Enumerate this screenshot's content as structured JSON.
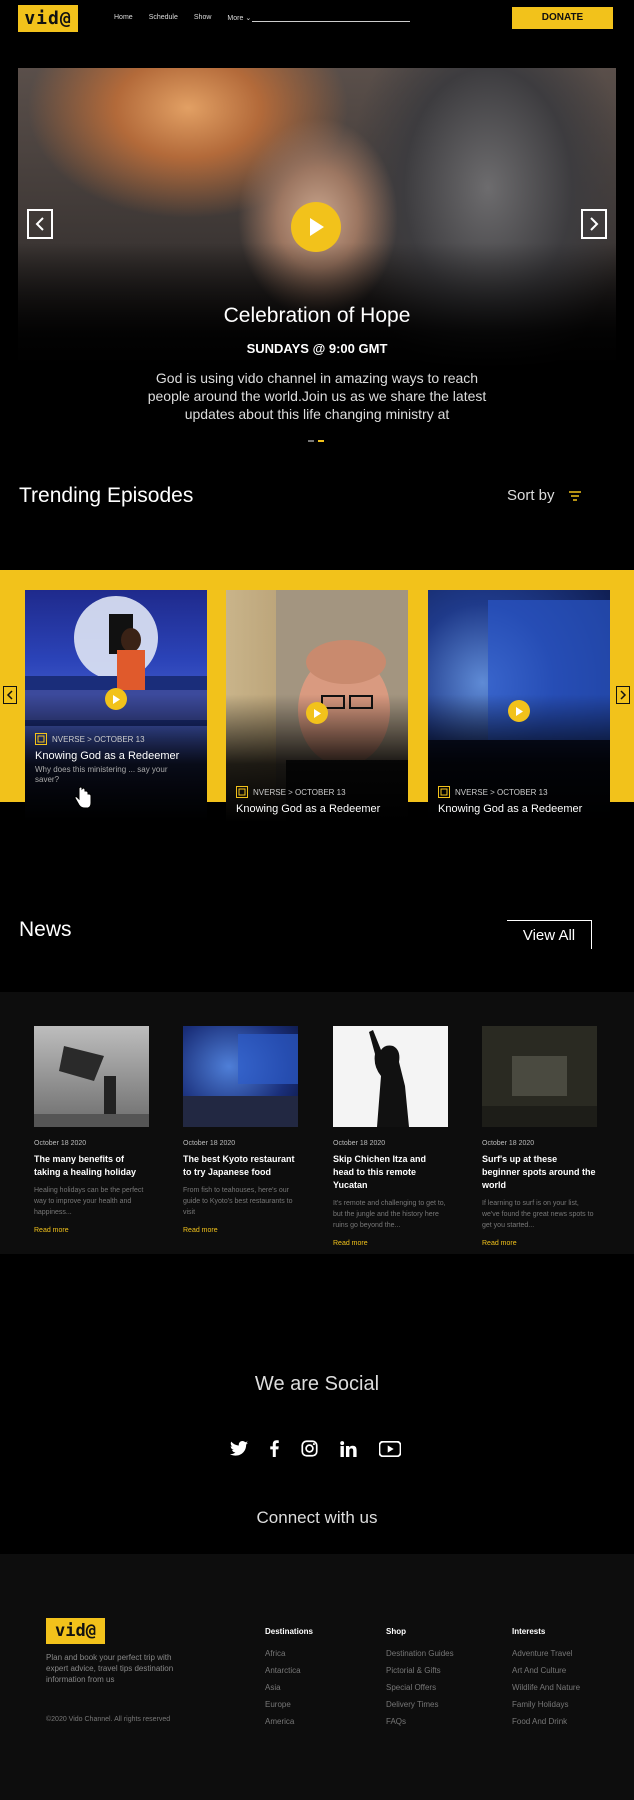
{
  "header": {
    "logo": "vid@",
    "nav": [
      "Home",
      "Schedule",
      "Show",
      "More"
    ],
    "donate": "DONATE"
  },
  "hero": {
    "title": "Celebration of Hope",
    "subtitle": "SUNDAYS @ 9:00 GMT",
    "description": "God is using vido channel in amazing ways to reach people around the world.Join us as we share the latest updates about this life changing ministry at",
    "slide_count": 2,
    "active_slide": 2
  },
  "trending": {
    "title": "Trending Episodes",
    "sort_label": "Sort by",
    "cards": [
      {
        "meta": "NVERSE > OCTOBER 13",
        "title": "Knowing God as a Redeemer",
        "desc": "Why does this ministering ... say your saver?"
      },
      {
        "meta": "NVERSE > OCTOBER 13",
        "title": "Knowing God as a Redeemer"
      },
      {
        "meta": "NVERSE > OCTOBER 13",
        "title": "Knowing God as a Redeemer"
      }
    ]
  },
  "news": {
    "title": "News",
    "view_all": "View All",
    "items": [
      {
        "date": "October 18 2020",
        "title": "The many benefits of taking a healing holiday",
        "desc": "Healing holidays can be the perfect way to improve your health and happiness...",
        "more": "Read more"
      },
      {
        "date": "October 18 2020",
        "title": "The best Kyoto restaurant to try Japanese food",
        "desc": "From fish to teahouses, here's our guide to Kyoto's best restaurants to visit",
        "more": "Read more"
      },
      {
        "date": "October 18 2020",
        "title": "Skip Chichen Itza and head to this remote Yucatan",
        "desc": "It's remote and challenging to get to, but the jungle and the history here ruins go beyond the...",
        "more": "Read more"
      },
      {
        "date": "October 18 2020",
        "title": "Surf's up at these beginner spots around the world",
        "desc": "If learning to surf is on your list, we've found the great news spots to get you started...",
        "more": "Read more"
      }
    ]
  },
  "social": {
    "title": "We are Social",
    "icons": [
      "twitter-icon",
      "facebook-icon",
      "instagram-icon",
      "linkedin-icon",
      "youtube-icon"
    ],
    "connect": "Connect with us"
  },
  "footer": {
    "logo": "vid@",
    "tagline": "Plan and book your perfect trip with expert advice, travel tips destination information from us",
    "copyright": "©2020 Vido Channel. All rights reserved",
    "columns": [
      {
        "title": "Destinations",
        "links": [
          "Africa",
          "Antarctica",
          "Asia",
          "Europe",
          "America"
        ]
      },
      {
        "title": "Shop",
        "links": [
          "Destination Guides",
          "Pictorial & Gifts",
          "Special Offers",
          "Delivery Times",
          "FAQs"
        ]
      },
      {
        "title": "Interests",
        "links": [
          "Adventure Travel",
          "Art And Culture",
          "Wildlife And Nature",
          "Family Holidays",
          "Food And Drink"
        ]
      }
    ]
  },
  "colors": {
    "accent": "#f2c21b",
    "background": "#000000",
    "band": "#0d0d0d"
  }
}
